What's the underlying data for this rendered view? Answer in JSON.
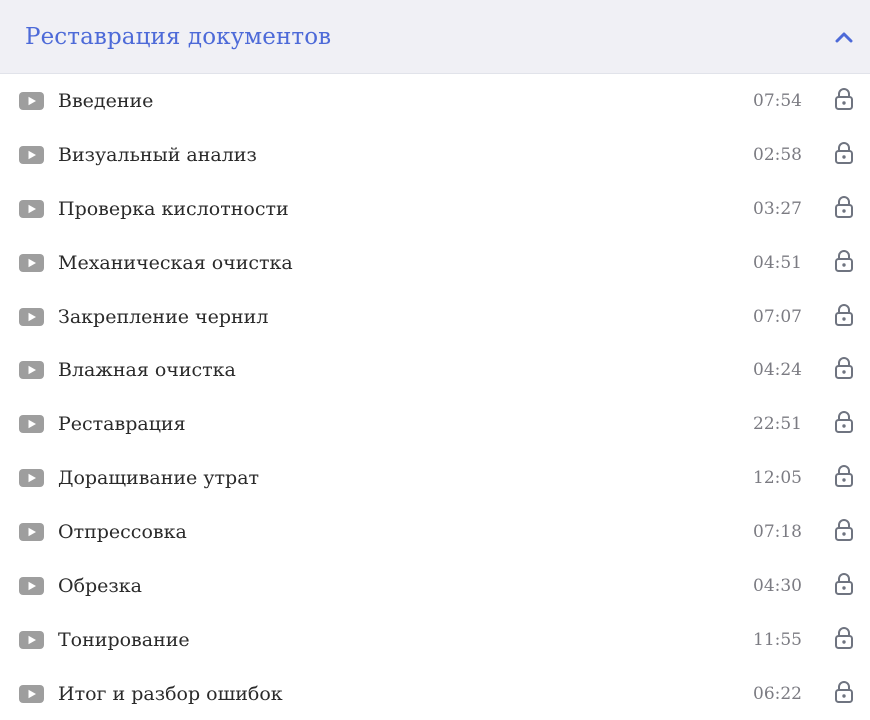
{
  "section": {
    "title": "Реставрация документов",
    "expanded": true,
    "accent_color": "#4d6ad8",
    "header_bg": "#f0f0f5",
    "chevron_icon": "chevron-up-icon"
  },
  "lessons": [
    {
      "title": "Введение",
      "duration": "07:54",
      "locked": true
    },
    {
      "title": "Визуальный анализ",
      "duration": "02:58",
      "locked": true
    },
    {
      "title": "Проверка кислотности",
      "duration": "03:27",
      "locked": true
    },
    {
      "title": "Механическая очистка",
      "duration": "04:51",
      "locked": true
    },
    {
      "title": "Закрепление чернил",
      "duration": "07:07",
      "locked": true
    },
    {
      "title": "Влажная очистка",
      "duration": "04:24",
      "locked": true
    },
    {
      "title": "Реставрация",
      "duration": "22:51",
      "locked": true
    },
    {
      "title": "Доращивание утрат",
      "duration": "12:05",
      "locked": true
    },
    {
      "title": "Отпрессовка",
      "duration": "07:18",
      "locked": true
    },
    {
      "title": "Обрезка",
      "duration": "04:30",
      "locked": true
    },
    {
      "title": "Тонирование",
      "duration": "11:55",
      "locked": true
    },
    {
      "title": "Итог и разбор ошибок",
      "duration": "06:22",
      "locked": true
    }
  ],
  "icons": {
    "lesson_type": "play-video-icon",
    "lock": "lock-icon"
  }
}
